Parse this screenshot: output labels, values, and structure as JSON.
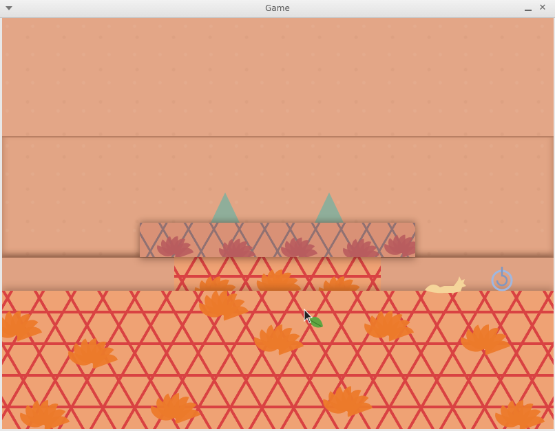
{
  "window": {
    "title": "Game",
    "menu_icon": "chevron-down-icon",
    "minimize_icon": "minimize-icon",
    "close_glyph": "✕"
  },
  "scene": {
    "colors": {
      "paper": "#e3a687",
      "ground_base": "#efa274",
      "ground_lattice": "#d6323a",
      "ground_leaves": "#ec7a2a",
      "platform_lattice": "#7e6a72",
      "platform_leaves": "#b85c5e",
      "spikes": "#8fae9a",
      "fox": "#f5d59a",
      "portal": "#9fb7e0",
      "leaf_cursor": "#5fa642"
    },
    "hazards": [
      "spike",
      "spike"
    ],
    "character": "fox",
    "goal": "spiral-portal",
    "pointer": "leaf-cursor"
  }
}
